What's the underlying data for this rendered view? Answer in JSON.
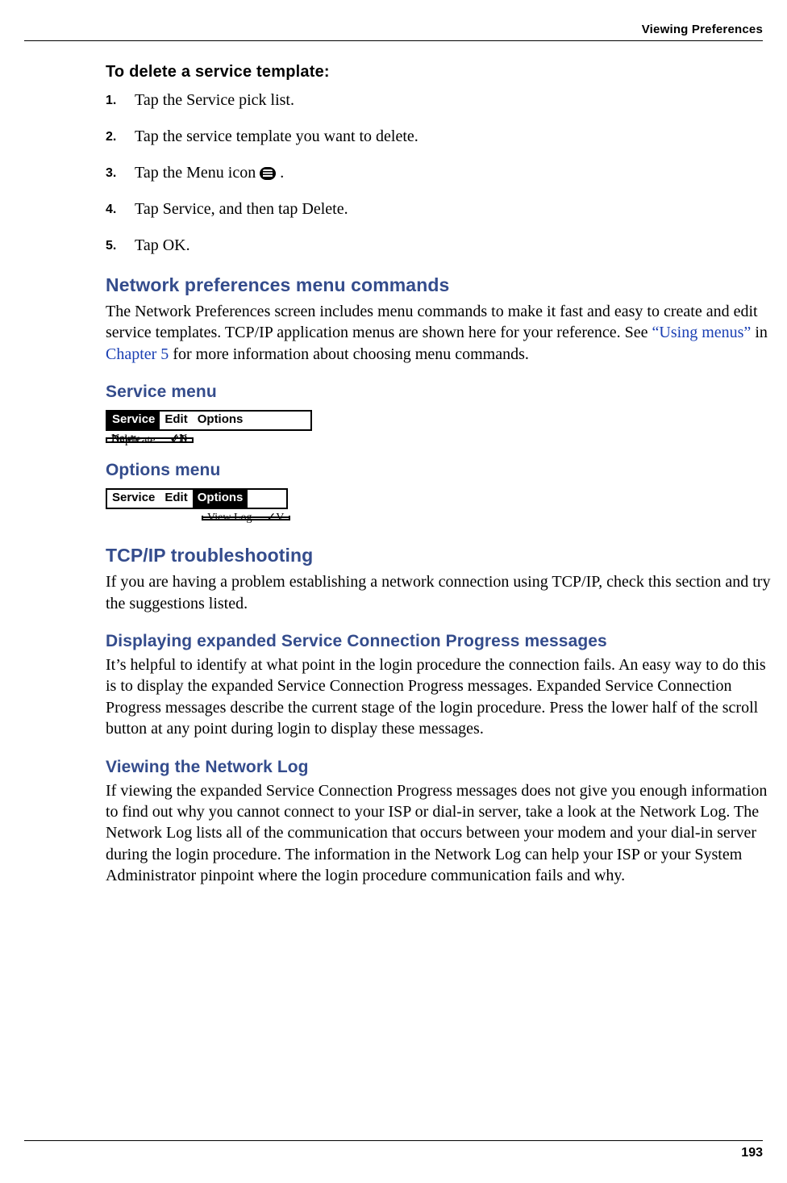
{
  "header": {
    "right": "Viewing Preferences"
  },
  "task": {
    "title": "To delete a service template:"
  },
  "steps": [
    "Tap the Service pick list.",
    "Tap the service template you want to delete.",
    "Tap the Menu icon ",
    "Tap Service, and then tap Delete.",
    "Tap OK."
  ],
  "step3_tail": " .",
  "sections": {
    "netprefs": {
      "title": "Network preferences menu commands",
      "p_a": "The Network Preferences screen includes menu commands to make it fast and easy to create and edit service templates. TCP/IP application menus are shown here for your reference. See ",
      "link1": "“Using menus”",
      "p_b": " in ",
      "link2": "Chapter 5",
      "p_c": " for more information about choosing menu commands."
    },
    "service_menu": {
      "title": "Service menu"
    },
    "options_menu": {
      "title": "Options menu"
    },
    "tcpip": {
      "title": "TCP/IP troubleshooting",
      "p": "If you are having a problem establishing a network connection using TCP/IP, check this section and try the suggestions listed."
    },
    "progress": {
      "title": "Displaying expanded Service Connection Progress messages",
      "p": "It’s helpful to identify at what point in the login procedure the connection fails. An easy way to do this is to display the expanded Service Connection Progress messages. Expanded Service Connection Progress messages describe the current stage of the login procedure. Press the lower half of the scroll button at any point during login to display these messages."
    },
    "netlog": {
      "title": "Viewing the Network Log",
      "p": "If viewing the expanded Service Connection Progress messages does not give you enough information to find out why you cannot connect to your ISP or dial-in server, take a look at the Network Log. The Network Log lists all of the communication that occurs between your modem and your dial-in server during the login procedure. The information in the Network Log can help your ISP or your System Administrator pinpoint where the login procedure communication fails and why."
    }
  },
  "menus": {
    "service": {
      "bar": [
        "Service",
        "Edit",
        "Options"
      ],
      "selected": 0,
      "items": [
        {
          "label": "New",
          "shortcut": "✓N"
        },
        {
          "label": "Delete…",
          "shortcut": "✓D"
        },
        {
          "label": "Duplicate",
          "shortcut": "✓L"
        }
      ]
    },
    "options": {
      "bar": [
        "Service",
        "Edit",
        "Options"
      ],
      "selected": 2,
      "items": [
        {
          "label": "View Log",
          "shortcut": "✓V"
        }
      ]
    }
  },
  "page_number": "193"
}
